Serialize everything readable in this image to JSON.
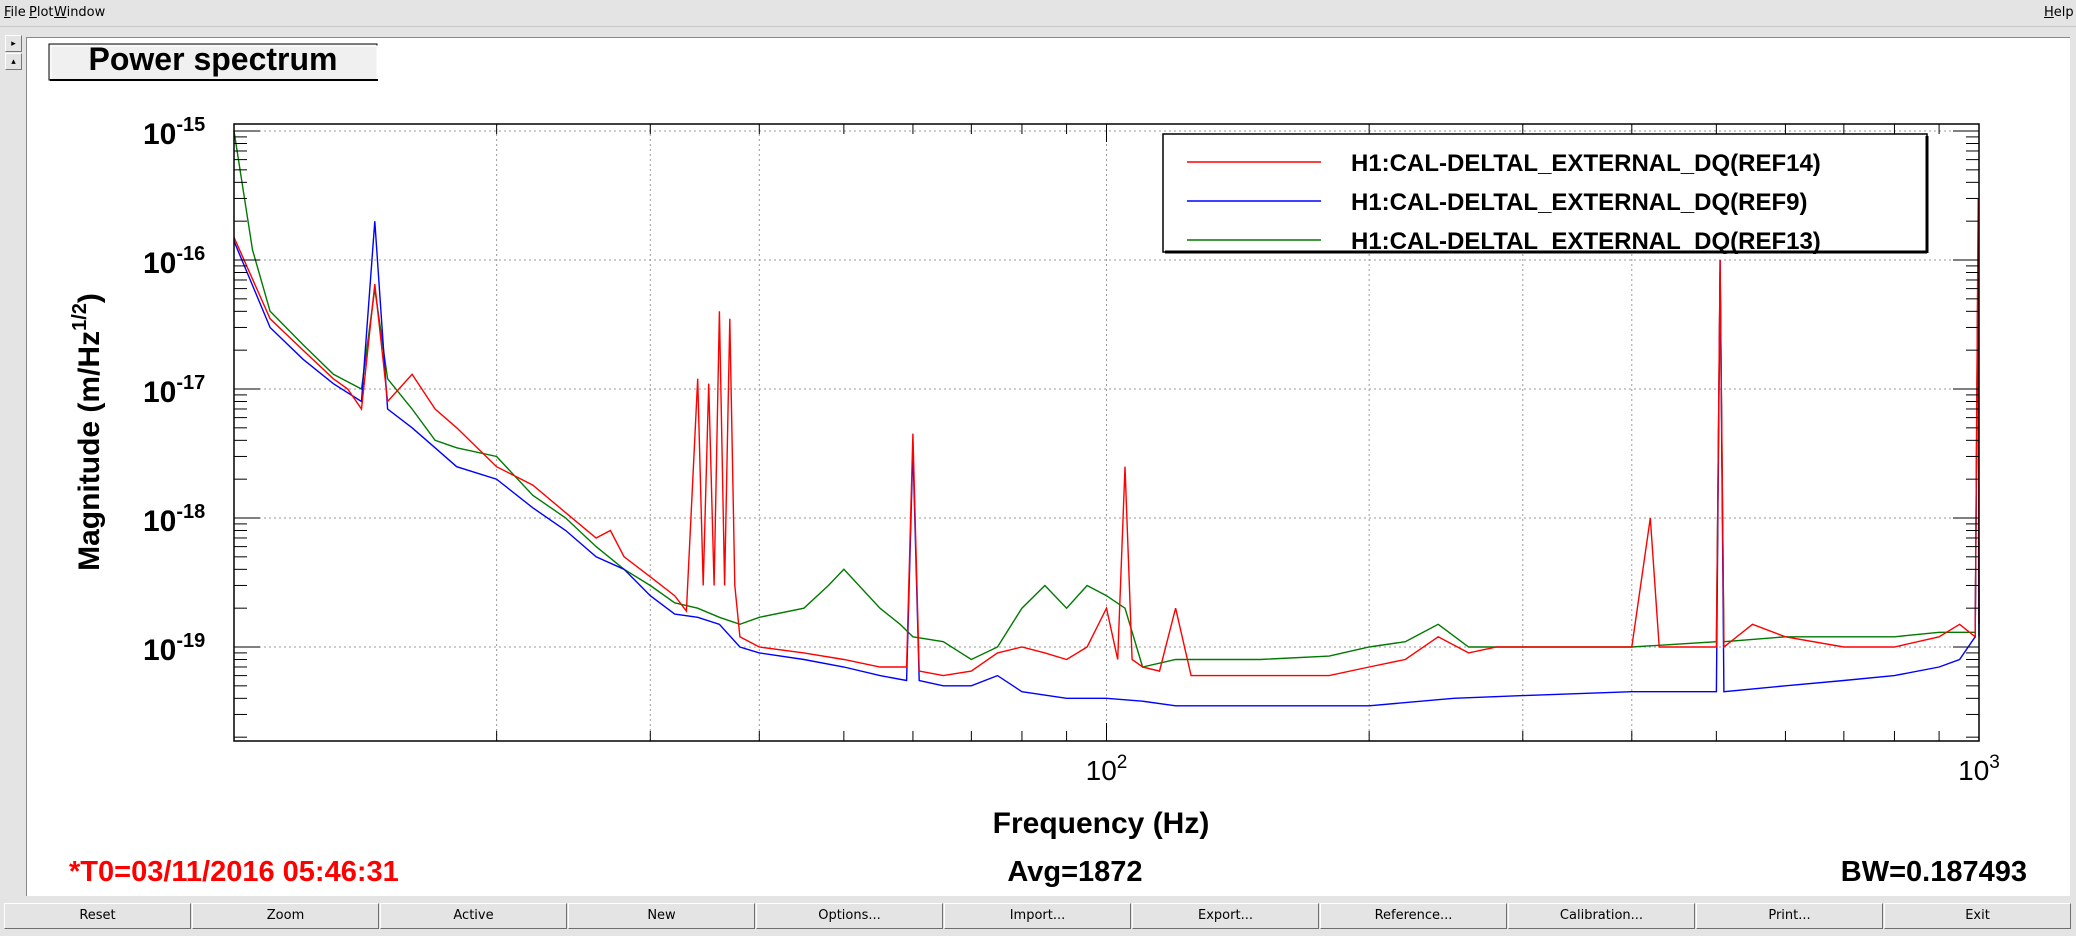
{
  "menubar": {
    "file": "File",
    "plot": "Plot",
    "window": "Window",
    "help": "Help"
  },
  "plot": {
    "title": "Power spectrum",
    "t0": "*T0=03/11/2016 05:46:31",
    "avg": "Avg=1872",
    "bw": "BW=0.187493"
  },
  "colors": {
    "ref14": "#ff0000",
    "ref9": "#0000ff",
    "ref13": "#007a00",
    "t0_text": "#ff0000"
  },
  "chart_data": {
    "type": "line",
    "title": "Power spectrum",
    "xlabel": "Frequency (Hz)",
    "ylabel_main": "Magnitude (m/Hz",
    "ylabel_sup": "1/2",
    "ylabel_close": ")",
    "xscale": "log",
    "yscale": "log",
    "xlim": [
      10,
      1000
    ],
    "ylim": [
      5e-20,
      1e-15
    ],
    "grid": true,
    "legend_position": "top-right",
    "x_tick_labels": [
      {
        "value": 100,
        "base": "10",
        "exp": "2"
      },
      {
        "value": 1000,
        "base": "10",
        "exp": "3"
      }
    ],
    "y_tick_labels": [
      {
        "value": 1e-15,
        "base": "10",
        "exp": "-15"
      },
      {
        "value": 1e-16,
        "base": "10",
        "exp": "-16"
      },
      {
        "value": 1e-17,
        "base": "10",
        "exp": "-17"
      },
      {
        "value": 1e-18,
        "base": "10",
        "exp": "-18"
      },
      {
        "value": 1e-19,
        "base": "10",
        "exp": "-19"
      }
    ],
    "series": [
      {
        "name": "H1:CAL-DELTAL_EXTERNAL_DQ(REF14)",
        "color": "#ff0000",
        "points": [
          [
            10,
            1.5e-16
          ],
          [
            11,
            3.5e-17
          ],
          [
            12,
            2e-17
          ],
          [
            13,
            1.2e-17
          ],
          [
            13.5,
            1e-17
          ],
          [
            14,
            7e-18
          ],
          [
            14.5,
            6.5e-17
          ],
          [
            15,
            8e-18
          ],
          [
            16,
            1.3e-17
          ],
          [
            17,
            7e-18
          ],
          [
            18,
            5e-18
          ],
          [
            20,
            2.5e-18
          ],
          [
            22,
            1.8e-18
          ],
          [
            24,
            1.1e-18
          ],
          [
            26,
            7e-19
          ],
          [
            27,
            8e-19
          ],
          [
            28,
            5e-19
          ],
          [
            30,
            3.5e-19
          ],
          [
            32,
            2.5e-19
          ],
          [
            33,
            1.9e-19
          ],
          [
            34,
            1.2e-17
          ],
          [
            34.5,
            3e-19
          ],
          [
            35,
            1.1e-17
          ],
          [
            35.5,
            3e-19
          ],
          [
            36,
            4e-17
          ],
          [
            36.5,
            3e-19
          ],
          [
            37,
            3.5e-17
          ],
          [
            37.5,
            3e-19
          ],
          [
            38,
            1.2e-19
          ],
          [
            40,
            1e-19
          ],
          [
            45,
            9e-20
          ],
          [
            50,
            8e-20
          ],
          [
            55,
            7e-20
          ],
          [
            59,
            7e-20
          ],
          [
            60,
            4.5e-18
          ],
          [
            61,
            6.5e-20
          ],
          [
            65,
            6e-20
          ],
          [
            70,
            6.5e-20
          ],
          [
            75,
            9e-20
          ],
          [
            80,
            1e-19
          ],
          [
            85,
            9e-20
          ],
          [
            90,
            8e-20
          ],
          [
            95,
            1e-19
          ],
          [
            100,
            2e-19
          ],
          [
            103,
            8e-20
          ],
          [
            105,
            2.5e-18
          ],
          [
            107,
            8e-20
          ],
          [
            110,
            7e-20
          ],
          [
            115,
            6.5e-20
          ],
          [
            120,
            2e-19
          ],
          [
            125,
            6e-20
          ],
          [
            130,
            6e-20
          ],
          [
            150,
            6e-20
          ],
          [
            180,
            6e-20
          ],
          [
            200,
            7e-20
          ],
          [
            220,
            8e-20
          ],
          [
            240,
            1.2e-19
          ],
          [
            260,
            9e-20
          ],
          [
            280,
            1e-19
          ],
          [
            300,
            1e-19
          ],
          [
            350,
            1e-19
          ],
          [
            400,
            1e-19
          ],
          [
            420,
            1e-18
          ],
          [
            430,
            1e-19
          ],
          [
            480,
            1e-19
          ],
          [
            500,
            1e-19
          ],
          [
            505,
            1e-16
          ],
          [
            510,
            1e-19
          ],
          [
            550,
            1.5e-19
          ],
          [
            600,
            1.2e-19
          ],
          [
            700,
            1e-19
          ],
          [
            800,
            1e-19
          ],
          [
            900,
            1.2e-19
          ],
          [
            950,
            1.5e-19
          ],
          [
            990,
            1.2e-19
          ],
          [
            998,
            3e-16
          ],
          [
            1000,
            1.5e-19
          ]
        ]
      },
      {
        "name": "H1:CAL-DELTAL_EXTERNAL_DQ(REF9)",
        "color": "#0000ff",
        "points": [
          [
            10,
            1.4e-16
          ],
          [
            11,
            3e-17
          ],
          [
            12,
            1.7e-17
          ],
          [
            13,
            1.1e-17
          ],
          [
            14,
            8e-18
          ],
          [
            14.5,
            2e-16
          ],
          [
            15,
            7e-18
          ],
          [
            16,
            5e-18
          ],
          [
            17,
            3.5e-18
          ],
          [
            18,
            2.5e-18
          ],
          [
            20,
            2e-18
          ],
          [
            22,
            1.2e-18
          ],
          [
            24,
            8e-19
          ],
          [
            26,
            5e-19
          ],
          [
            28,
            4e-19
          ],
          [
            30,
            2.5e-19
          ],
          [
            32,
            1.8e-19
          ],
          [
            34,
            1.7e-19
          ],
          [
            36,
            1.5e-19
          ],
          [
            38,
            1e-19
          ],
          [
            40,
            9e-20
          ],
          [
            45,
            8e-20
          ],
          [
            50,
            7e-20
          ],
          [
            55,
            6e-20
          ],
          [
            59,
            5.5e-20
          ],
          [
            60,
            3.5e-18
          ],
          [
            61,
            5.5e-20
          ],
          [
            65,
            5e-20
          ],
          [
            70,
            5e-20
          ],
          [
            75,
            6e-20
          ],
          [
            80,
            4.5e-20
          ],
          [
            90,
            4e-20
          ],
          [
            100,
            4e-20
          ],
          [
            110,
            3.8e-20
          ],
          [
            120,
            3.5e-20
          ],
          [
            150,
            3.5e-20
          ],
          [
            200,
            3.5e-20
          ],
          [
            250,
            4e-20
          ],
          [
            300,
            4.2e-20
          ],
          [
            400,
            4.5e-20
          ],
          [
            500,
            4.5e-20
          ],
          [
            505,
            1e-16
          ],
          [
            510,
            4.5e-20
          ],
          [
            600,
            5e-20
          ],
          [
            700,
            5.5e-20
          ],
          [
            800,
            6e-20
          ],
          [
            900,
            7e-20
          ],
          [
            950,
            8e-20
          ],
          [
            990,
            1.2e-19
          ],
          [
            998,
            1.5e-16
          ],
          [
            1000,
            1.2e-19
          ]
        ]
      },
      {
        "name": "H1:CAL-DELTAL_EXTERNAL_DQ(REF13)",
        "color": "#007a00",
        "points": [
          [
            10,
            1e-15
          ],
          [
            10.5,
            1.2e-16
          ],
          [
            11,
            4e-17
          ],
          [
            12,
            2.2e-17
          ],
          [
            13,
            1.3e-17
          ],
          [
            14,
            1e-17
          ],
          [
            14.5,
            6e-17
          ],
          [
            15,
            1.2e-17
          ],
          [
            16,
            7e-18
          ],
          [
            17,
            4e-18
          ],
          [
            18,
            3.5e-18
          ],
          [
            20,
            3e-18
          ],
          [
            22,
            1.5e-18
          ],
          [
            24,
            1e-18
          ],
          [
            26,
            6e-19
          ],
          [
            28,
            4e-19
          ],
          [
            30,
            3e-19
          ],
          [
            32,
            2.2e-19
          ],
          [
            34,
            2e-19
          ],
          [
            36,
            1.7e-19
          ],
          [
            38,
            1.5e-19
          ],
          [
            40,
            1.7e-19
          ],
          [
            45,
            2e-19
          ],
          [
            48,
            3e-19
          ],
          [
            50,
            4e-19
          ],
          [
            55,
            2e-19
          ],
          [
            58,
            1.5e-19
          ],
          [
            60,
            1.2e-19
          ],
          [
            65,
            1.1e-19
          ],
          [
            70,
            8e-20
          ],
          [
            75,
            1e-19
          ],
          [
            80,
            2e-19
          ],
          [
            85,
            3e-19
          ],
          [
            90,
            2e-19
          ],
          [
            95,
            3e-19
          ],
          [
            100,
            2.5e-19
          ],
          [
            105,
            2e-19
          ],
          [
            110,
            7e-20
          ],
          [
            120,
            8e-20
          ],
          [
            150,
            8e-20
          ],
          [
            180,
            8.5e-20
          ],
          [
            200,
            1e-19
          ],
          [
            220,
            1.1e-19
          ],
          [
            240,
            1.5e-19
          ],
          [
            260,
            1e-19
          ],
          [
            300,
            1e-19
          ],
          [
            400,
            1e-19
          ],
          [
            500,
            1.1e-19
          ],
          [
            505,
            8e-17
          ],
          [
            510,
            1.1e-19
          ],
          [
            600,
            1.2e-19
          ],
          [
            800,
            1.2e-19
          ],
          [
            900,
            1.3e-19
          ],
          [
            990,
            1.3e-19
          ],
          [
            998,
            2e-16
          ],
          [
            1000,
            1.5e-19
          ]
        ]
      }
    ]
  },
  "buttons": [
    {
      "name": "reset-button",
      "label": "Reset"
    },
    {
      "name": "zoom-button",
      "label": "Zoom"
    },
    {
      "name": "active-button",
      "label": "Active"
    },
    {
      "name": "new-button",
      "label": "New"
    },
    {
      "name": "options-button",
      "label": "Options..."
    },
    {
      "name": "import-button",
      "label": "Import..."
    },
    {
      "name": "export-button",
      "label": "Export..."
    },
    {
      "name": "reference-button",
      "label": "Reference..."
    },
    {
      "name": "calibration-button",
      "label": "Calibration..."
    },
    {
      "name": "print-button",
      "label": "Print..."
    },
    {
      "name": "exit-button",
      "label": "Exit"
    }
  ]
}
